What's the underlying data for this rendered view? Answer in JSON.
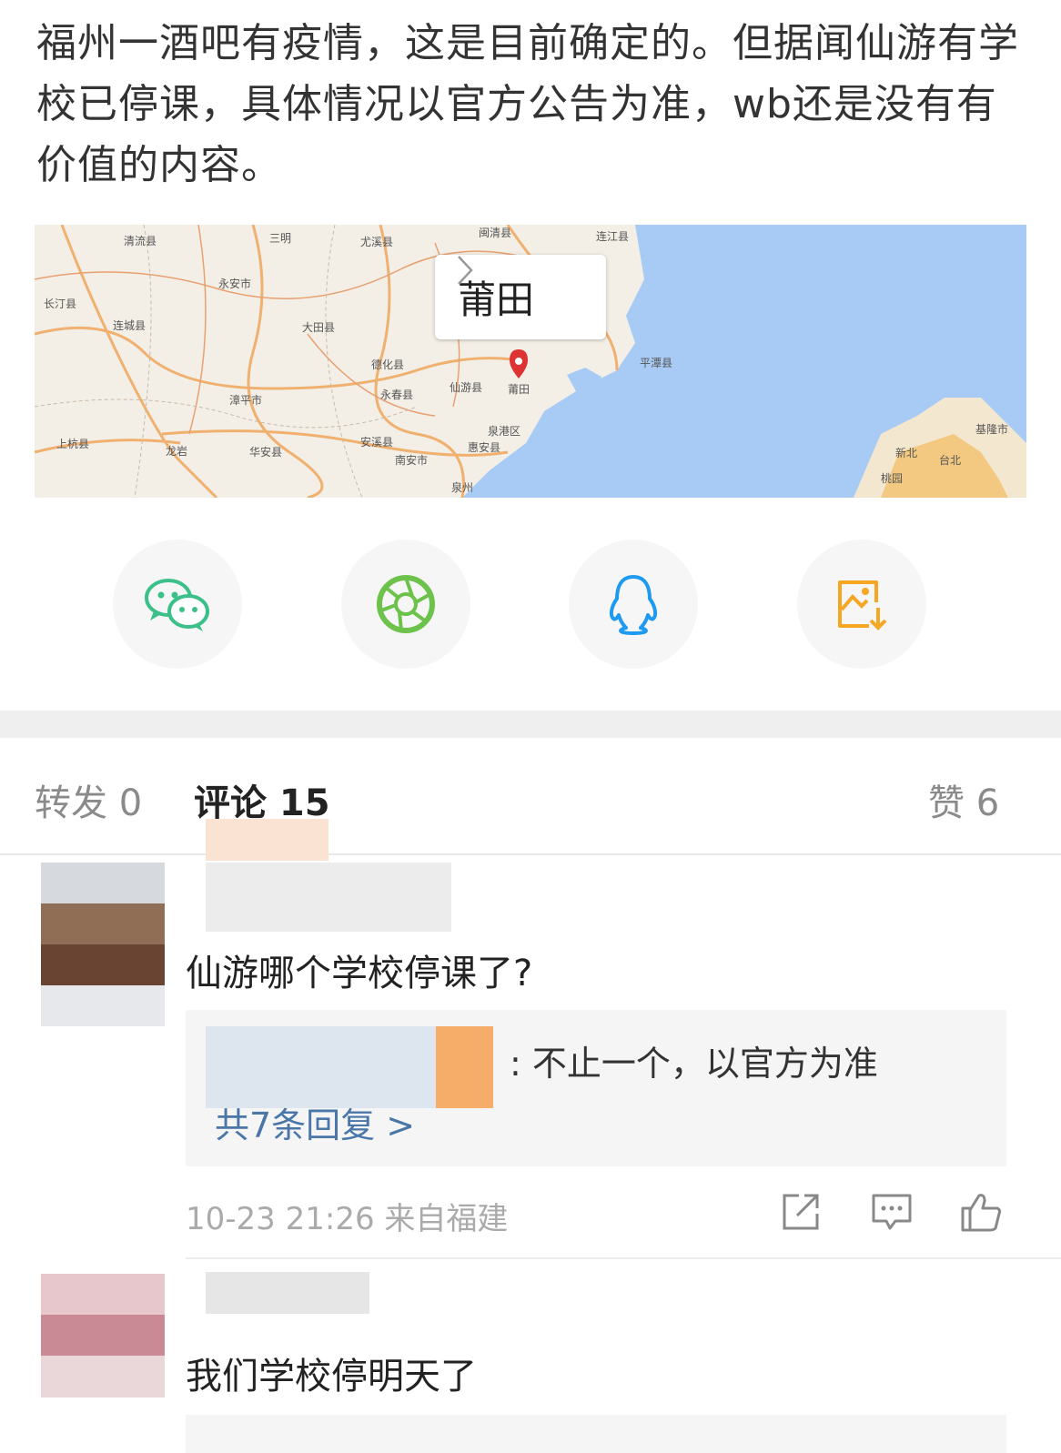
{
  "post": {
    "text": "福州一酒吧有疫情，这是目前确定的。但据闻仙游有学校已停课，具体情况以官方公告为准，wb还是没有有价值的内容。"
  },
  "map": {
    "popup_city": "莆田",
    "labels": [
      "清流县",
      "三明",
      "尤溪县",
      "闽清县",
      "连江县",
      "永安市",
      "长汀县",
      "连城县",
      "大田县",
      "德化县",
      "平潭县",
      "永春县",
      "仙游县",
      "莆田",
      "漳平市",
      "安溪县",
      "泉港区",
      "惠安县",
      "上杭县",
      "龙岩",
      "华安县",
      "南安市",
      "泉州",
      "新北",
      "台北",
      "桃园",
      "基隆市"
    ]
  },
  "share": {
    "icons": [
      "wechat-icon",
      "moments-icon",
      "qq-icon",
      "save-image-icon"
    ]
  },
  "tabs": {
    "repost": "转发 0",
    "comments": "评论 15",
    "likes": "赞 6"
  },
  "comments": [
    {
      "text": "仙游哪个学校停课了?",
      "reply_text": ": 不止一个，以官方为准",
      "reply_more": "共7条回复 >",
      "meta": "10-23 21:26  来自福建"
    },
    {
      "text": "我们学校停明天了"
    }
  ]
}
